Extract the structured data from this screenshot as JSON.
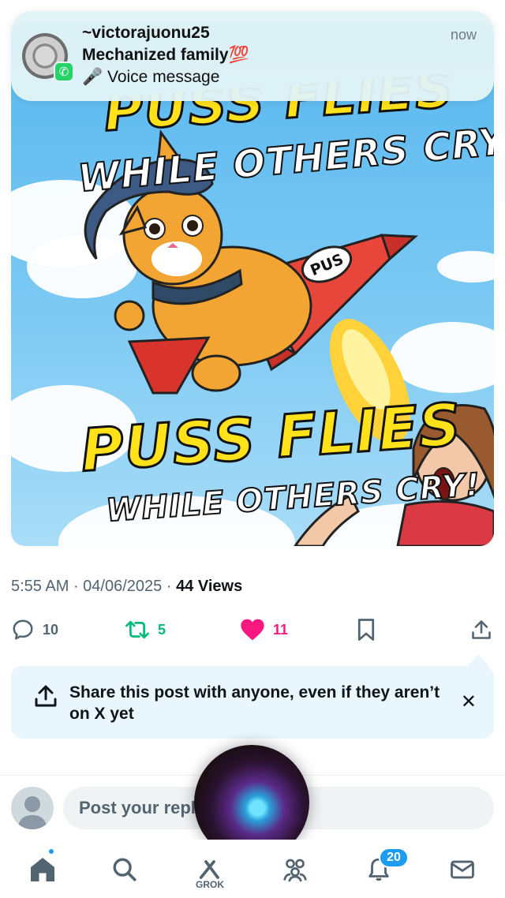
{
  "notification": {
    "sender": "~victorajuonu25",
    "group": "Mechanized family💯",
    "message": "🎤 Voice message",
    "time": "now",
    "app_icon": "whatsapp-icon"
  },
  "post": {
    "image": {
      "headline_top": "PUSS FLIES",
      "sub_top": "WHILE OTHERS CRY!",
      "rocket_label": "PUS",
      "headline_bottom": "PUSS FLIES",
      "sub_bottom": "WHILE OTHERS CRY!"
    },
    "time": "5:55 AM",
    "date": "04/06/2025",
    "views_count": "44",
    "views_label": "Views",
    "replies": "10",
    "reposts": "5",
    "likes": "11"
  },
  "share_banner": {
    "text": "Share this post with anyone, even if they aren’t on X yet"
  },
  "reply": {
    "placeholder": "Post your reply"
  },
  "tabbar": {
    "grok_label": "GROK",
    "notifications_count": "20"
  },
  "colors": {
    "accent": "#1d9bf0",
    "like": "#f91880",
    "repost": "#00ba7c",
    "muted": "#536471"
  }
}
